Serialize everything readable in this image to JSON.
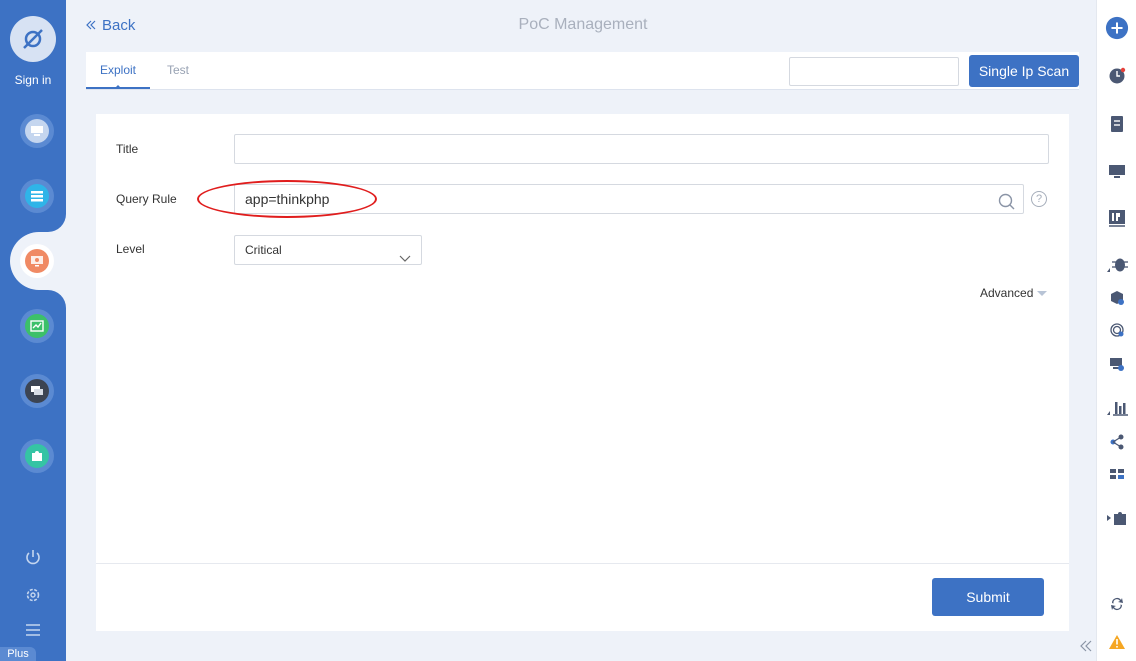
{
  "sidebar": {
    "signin_label": "Sign in",
    "plus_label": "Plus",
    "items": [
      {
        "name": "sidebar-item-monitor",
        "icon": "monitor-icon",
        "color": "#c5d6ef"
      },
      {
        "name": "sidebar-item-list",
        "icon": "list-icon",
        "color": "#2fb4e8"
      },
      {
        "name": "sidebar-item-poc",
        "icon": "bug-monitor-icon",
        "color": "#f08a64"
      },
      {
        "name": "sidebar-item-chart",
        "icon": "trend-chart-icon",
        "color": "#3cc06a"
      },
      {
        "name": "sidebar-item-messages",
        "icon": "chat-icon",
        "color": "#3c4452"
      },
      {
        "name": "sidebar-item-plugins",
        "icon": "puzzle-icon",
        "color": "#35c4a4"
      }
    ]
  },
  "header": {
    "back_label": "Back",
    "title": "PoC Management"
  },
  "tabs": {
    "exploit_label": "Exploit",
    "test_label": "Test",
    "ip_input_value": "",
    "scan_button_label": "Single Ip Scan"
  },
  "form": {
    "title_label": "Title",
    "title_value": "",
    "query_rule_label": "Query Rule",
    "query_rule_value": "app=thinkphp",
    "help_symbol": "?",
    "level_label": "Level",
    "level_value": "Critical",
    "advanced_label": "Advanced",
    "submit_label": "Submit"
  },
  "colors": {
    "primary": "#3d72c4",
    "annotation": "#e01d1d",
    "warning": "#f5a623"
  }
}
